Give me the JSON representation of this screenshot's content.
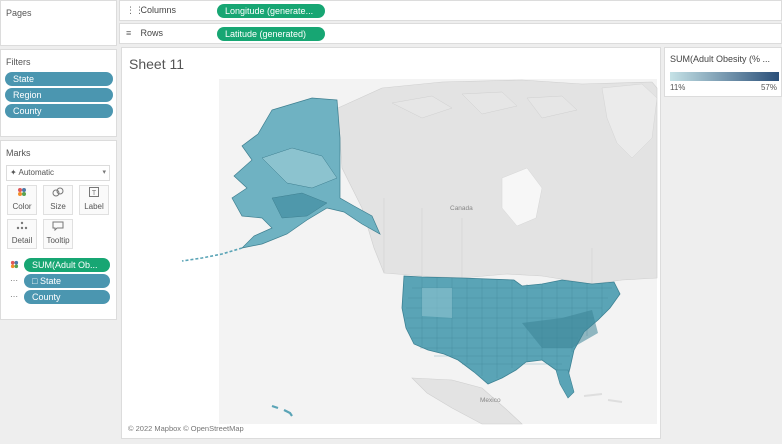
{
  "pages": {
    "title": "Pages"
  },
  "columns": {
    "label": "Columns",
    "field": "Longitude (generate..."
  },
  "rows": {
    "label": "Rows",
    "field": "Latitude (generated)"
  },
  "filters": {
    "title": "Filters",
    "items": [
      {
        "label": "State"
      },
      {
        "label": "Region"
      },
      {
        "label": "County"
      }
    ]
  },
  "marks": {
    "title": "Marks",
    "type": "Automatic",
    "buttons": [
      {
        "label": "Color",
        "icon": "color-icon"
      },
      {
        "label": "Size",
        "icon": "size-icon"
      },
      {
        "label": "Label",
        "icon": "label-icon"
      },
      {
        "label": "Detail",
        "icon": "detail-icon"
      },
      {
        "label": "Tooltip",
        "icon": "tooltip-icon"
      }
    ],
    "fields": [
      {
        "label": "SUM(Adult Ob...",
        "kind": "color"
      },
      {
        "label": "State",
        "kind": "detail"
      },
      {
        "label": "County",
        "kind": "detail"
      }
    ]
  },
  "view": {
    "title": "Sheet 11",
    "labels": {
      "canada": "Canada",
      "mexico": "Mexico"
    },
    "attribution": "© 2022 Mapbox © OpenStreetMap"
  },
  "legend": {
    "title": "SUM(Adult Obesity (% ...",
    "min": "11%",
    "max": "57%",
    "color_low": "#c5e2e6",
    "color_high": "#2a4f79"
  },
  "colors": {
    "filter_pill": "#4b96b0",
    "measure_pill": "#17a673",
    "map_fill": "#5aa4b6",
    "map_fill_dark": "#3c8193",
    "land": "#e6e6e6"
  }
}
